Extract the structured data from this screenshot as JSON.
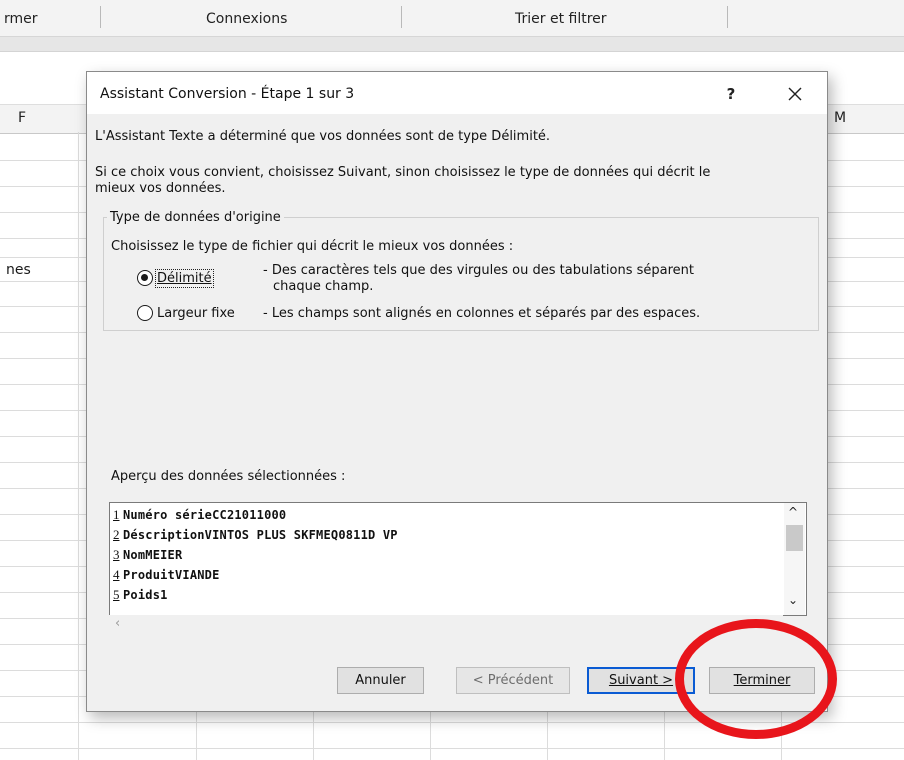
{
  "ribbon": {
    "groups": [
      "rmer",
      "Connexions",
      "Trier et filtrer"
    ]
  },
  "sheet": {
    "columns": {
      "left": "F",
      "right": "M"
    },
    "cell_fragment": "nes"
  },
  "dialog": {
    "title": "Assistant Conversion - Étape 1 sur 3",
    "help_label": "?",
    "intro_line1": "L'Assistant Texte a déterminé que vos données sont de type Délimité.",
    "intro_line2a": "Si ce choix vous convient, choisissez Suivant, sinon choisissez le type de données qui décrit le",
    "intro_line2b": "mieux vos données.",
    "group": {
      "legend": "Type de données d'origine",
      "prompt": "Choisissez le type de fichier qui décrit le mieux vos données :",
      "options": [
        {
          "label": "Délimité",
          "selected": true,
          "desc1": "- Des caractères tels que des virgules ou des tabulations séparent",
          "desc2": "chaque champ."
        },
        {
          "label": "Largeur fixe",
          "selected": false,
          "desc1": "- Les champs sont alignés en colonnes et séparés par des espaces."
        }
      ]
    },
    "preview": {
      "label": "Aperçu des données sélectionnées :",
      "rows": [
        {
          "n": "1",
          "text": "Numéro sérieCC21011000"
        },
        {
          "n": "2",
          "text": "DéscriptionVINTOS PLUS SKFMEQ0811D VP"
        },
        {
          "n": "3",
          "text": "NomMEIER"
        },
        {
          "n": "4",
          "text": "ProduitVIANDE"
        },
        {
          "n": "5",
          "text": "Poids1"
        }
      ]
    },
    "buttons": {
      "cancel": "Annuler",
      "previous": "< Précédent",
      "next": "Suivant >",
      "finish": "Terminer"
    }
  },
  "colors": {
    "dialog_bg": "#f0f0f0",
    "default_button_border": "#0a5bd3",
    "annotation_circle": "#e8151b"
  }
}
